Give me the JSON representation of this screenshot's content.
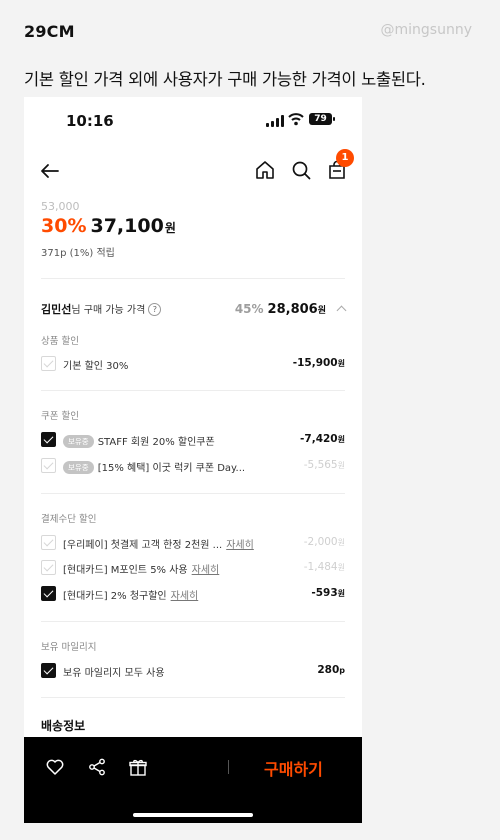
{
  "brand": "29CM",
  "handle": "@mingsunny",
  "caption": "기본 할인 가격 외에 사용자가 구매 가능한 가격이 노출된다.",
  "status_bar": {
    "time": "10:16",
    "battery": "79"
  },
  "nav": {
    "cart_count": "1"
  },
  "price": {
    "original": "53,000",
    "discount_rate": "30%",
    "amount": "37,100",
    "currency": "원",
    "points": "371p (1%) 적립"
  },
  "member_price": {
    "name": "김민선",
    "suffix": "님 구매 가능 가격",
    "help": "?",
    "rate": "45%",
    "amount": "28,806",
    "currency": "원"
  },
  "sections": {
    "product_discount": {
      "title": "상품 할인",
      "items": [
        {
          "label": "기본 할인 30%",
          "value": "-15,900",
          "unit": "원",
          "checked": false
        }
      ]
    },
    "coupon_discount": {
      "title": "쿠폰 할인",
      "items": [
        {
          "tag": "보유중",
          "label": "STAFF 회원 20% 할인쿠폰",
          "value": "-7,420",
          "unit": "원",
          "checked": true
        },
        {
          "tag": "보유중",
          "label": "[15% 혜택] 이굿 럭키 쿠폰 Day...",
          "value": "-5,565",
          "unit": "원",
          "checked": false
        }
      ]
    },
    "payment_discount": {
      "title": "결제수단 할인",
      "items": [
        {
          "label": "[우리페이] 첫결제 고객 한정 2천원 ...",
          "link": "자세히",
          "value": "-2,000",
          "unit": "원",
          "checked": false
        },
        {
          "label": "[현대카드] M포인트 5% 사용",
          "link": "자세히",
          "value": "-1,484",
          "unit": "원",
          "checked": false
        },
        {
          "label": "[현대카드] 2% 청구할인",
          "link": "자세히",
          "value": "-593",
          "unit": "원",
          "checked": true
        }
      ]
    },
    "mileage": {
      "title": "보유 마일리지",
      "items": [
        {
          "label": "보유 마일리지 모두 사용",
          "value": "280",
          "unit": "p",
          "checked": true
        }
      ]
    }
  },
  "shipping_title": "배송정보",
  "bottom_bar": {
    "buy_label": "구매하기"
  },
  "icons": [
    "back-arrow-icon",
    "home-icon",
    "search-icon",
    "shopping-bag-icon",
    "heart-icon",
    "share-icon",
    "gift-icon"
  ],
  "colors": {
    "accent": "#ff4b00",
    "bar": "#000000"
  }
}
